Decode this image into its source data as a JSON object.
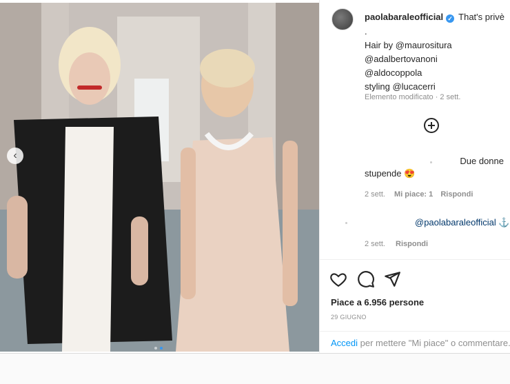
{
  "post": {
    "username": "paolabaraleofficial",
    "verified_icon": "verified-badge-icon",
    "caption_lines": [
      "That's privè",
      ".",
      "Hair by @maurositura",
      "@adalbertovanoni",
      "@aldocoppola",
      "styling @lucacerri"
    ],
    "edited": "Elemento modificato · 2 sett.",
    "add_icon": "plus-circle-icon"
  },
  "comments": [
    {
      "text_a": "Due donne",
      "text_b": "stupende 😍",
      "time": "2 sett.",
      "likes": "Mi piace: 1",
      "reply": "Rispondi"
    },
    {
      "text": "@paolabaraleofficial ⚓",
      "time": "2 sett.",
      "reply": "Rispondi"
    }
  ],
  "actions": {
    "like_icon": "heart-icon",
    "comment_icon": "comment-icon",
    "share_icon": "share-icon"
  },
  "likes_text": "Piace a 6.956 persone",
  "date": "29 GIUGNO",
  "footer": {
    "login": "Accedi",
    "rest": " per mettere \"Mi piace\" o commentare."
  },
  "carousel": {
    "prev_icon": "chevron-left-icon",
    "slide_count": 2,
    "active_slide": 2
  },
  "colors": {
    "link": "#00376b",
    "accent": "#0095f6",
    "muted": "#8e8e8e",
    "text": "#262626"
  }
}
